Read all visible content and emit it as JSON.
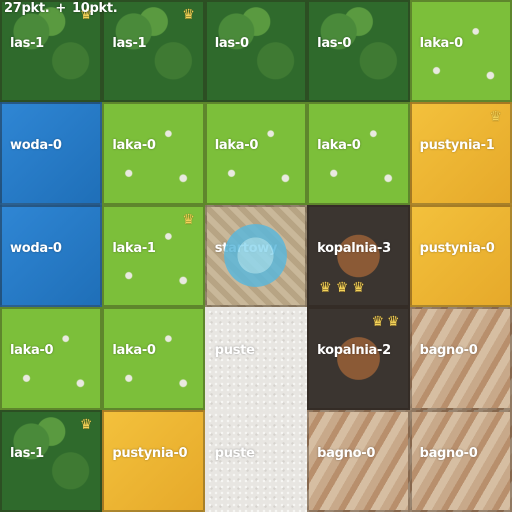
{
  "score": {
    "points": "27pkt.",
    "plus": "+",
    "bonus": "10pkt."
  },
  "crown_icon": "crown-icon",
  "colors": {
    "las": "#2f6a2c",
    "laka": "#7cbf3a",
    "woda": "#1f6fb8",
    "pustynia": "#e6a92a",
    "kopalnia": "#3b3530",
    "bagno": "#b88f6c",
    "startowy": "#c9b89a",
    "puste": "#e8e6e2"
  },
  "grid": [
    [
      {
        "label": "las-1",
        "type": "las",
        "crowns": 1
      },
      {
        "label": "las-1",
        "type": "las",
        "crowns": 1
      },
      {
        "label": "las-0",
        "type": "las",
        "crowns": 0
      },
      {
        "label": "las-0",
        "type": "las",
        "crowns": 0
      },
      {
        "label": "laka-0",
        "type": "laka",
        "crowns": 0
      }
    ],
    [
      {
        "label": "woda-0",
        "type": "woda",
        "crowns": 0
      },
      {
        "label": "laka-0",
        "type": "laka",
        "crowns": 0
      },
      {
        "label": "laka-0",
        "type": "laka",
        "crowns": 0
      },
      {
        "label": "laka-0",
        "type": "laka",
        "crowns": 0
      },
      {
        "label": "pustynia-1",
        "type": "pustynia",
        "crowns": 1
      }
    ],
    [
      {
        "label": "woda-0",
        "type": "woda",
        "crowns": 0
      },
      {
        "label": "laka-1",
        "type": "laka",
        "crowns": 1
      },
      {
        "label": "startowy",
        "type": "startowy",
        "crowns": 0
      },
      {
        "label": "kopalnia-3",
        "type": "kopalnia",
        "crowns": 3
      },
      {
        "label": "pustynia-0",
        "type": "pustynia",
        "crowns": 0
      }
    ],
    [
      {
        "label": "laka-0",
        "type": "laka",
        "crowns": 0
      },
      {
        "label": "laka-0",
        "type": "laka",
        "crowns": 0
      },
      {
        "label": "puste",
        "type": "puste",
        "crowns": 0
      },
      {
        "label": "kopalnia-2",
        "type": "kopalnia",
        "crowns": 2
      },
      {
        "label": "bagno-0",
        "type": "bagno",
        "crowns": 0
      }
    ],
    [
      {
        "label": "las-1",
        "type": "las",
        "crowns": 1
      },
      {
        "label": "pustynia-0",
        "type": "pustynia",
        "crowns": 0
      },
      {
        "label": "puste",
        "type": "puste",
        "crowns": 0
      },
      {
        "label": "bagno-0",
        "type": "bagno",
        "crowns": 0
      },
      {
        "label": "bagno-0",
        "type": "bagno",
        "crowns": 0
      }
    ]
  ]
}
